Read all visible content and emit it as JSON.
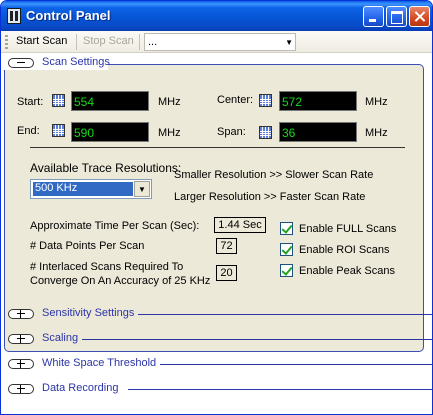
{
  "window": {
    "title": "Control Panel"
  },
  "toolbar": {
    "start_label": "Start Scan",
    "stop_label": "Stop Scan",
    "combo_value": "..."
  },
  "scan_settings": {
    "header": "Scan Settings",
    "start": {
      "label": "Start:",
      "value": "554",
      "unit": "MHz"
    },
    "end": {
      "label": "End:",
      "value": "590",
      "unit": "MHz"
    },
    "center": {
      "label": "Center:",
      "value": "572",
      "unit": "MHz"
    },
    "span": {
      "label": "Span:",
      "value": "36",
      "unit": "MHz"
    },
    "resolutions_label": "Available Trace Resolutions:",
    "resolution_selected": "500 KHz",
    "note_smaller": "Smaller Resolution >> Slower Scan Rate",
    "note_larger": "Larger Resolution  >> Faster Scan Rate",
    "time_label": "Approximate Time Per Scan (Sec):",
    "time_value": "1.44 Sec",
    "points_label": "# Data Points Per Scan",
    "points_value": "72",
    "interlaced_label_1": "# Interlaced Scans Required To",
    "interlaced_label_2": "Converge On An Accuracy of 25 KHz",
    "interlaced_value": "20",
    "checkboxes": [
      {
        "label": "Enable FULL Scans",
        "checked": true
      },
      {
        "label": "Enable ROI Scans",
        "checked": true
      },
      {
        "label": "Enable Peak Scans",
        "checked": true
      }
    ]
  },
  "sections": [
    {
      "label": "Sensitivity Settings"
    },
    {
      "label": "Scaling"
    },
    {
      "label": "White Space Threshold"
    },
    {
      "label": "Data Recording"
    }
  ],
  "colors": {
    "accent": "#2b35a8",
    "lcd_text": "#16d916",
    "titlebar": "#0553D2"
  }
}
